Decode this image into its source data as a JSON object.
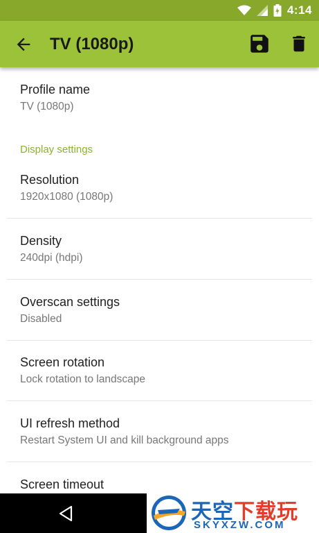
{
  "status_bar": {
    "time": "4:14"
  },
  "toolbar": {
    "title": "TV (1080p)"
  },
  "preferences": {
    "profile_name": {
      "title": "Profile name",
      "summary": "TV (1080p)"
    },
    "category_display": "Display settings",
    "resolution": {
      "title": "Resolution",
      "summary": "1920x1080 (1080p)"
    },
    "density": {
      "title": "Density",
      "summary": "240dpi (hdpi)"
    },
    "overscan": {
      "title": "Overscan settings",
      "summary": "Disabled"
    },
    "rotation": {
      "title": "Screen rotation",
      "summary": "Lock rotation to landscape"
    },
    "refresh": {
      "title": "UI refresh method",
      "summary": "Restart System UI and kill background apps"
    },
    "timeout": {
      "title": "Screen timeout"
    }
  },
  "watermark": {
    "cn_blue": "天空",
    "cn_red": "下载玩",
    "en": "SKYXZW.COM"
  },
  "colors": {
    "status_bar": "#87a82a",
    "toolbar": "#9cc23a",
    "accent": "#8cb32c"
  }
}
